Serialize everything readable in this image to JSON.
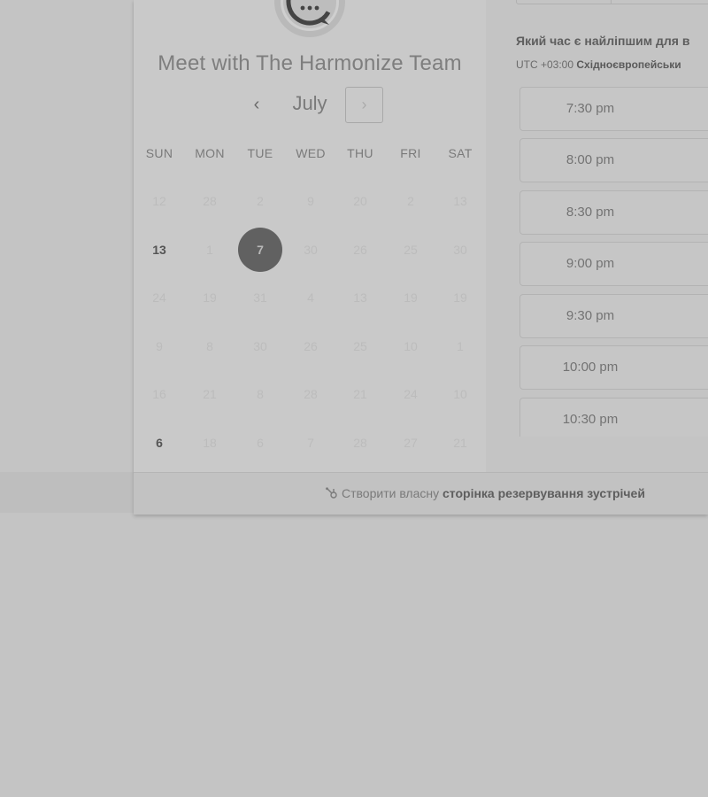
{
  "calendar": {
    "title": "Meet with The Harmonize Team",
    "month": "July",
    "prev_glyph": "‹",
    "next_glyph": "›",
    "weekdays": [
      "SUN",
      "MON",
      "TUE",
      "WED",
      "THU",
      "FRI",
      "SAT"
    ],
    "weeks": [
      [
        "12",
        "28",
        "2",
        "9",
        "20",
        "2",
        "13"
      ],
      [
        "13",
        "1",
        "7",
        "30",
        "26",
        "25",
        "30"
      ],
      [
        "24",
        "19",
        "31",
        "4",
        "13",
        "19",
        "19"
      ],
      [
        "9",
        "8",
        "30",
        "26",
        "25",
        "10",
        "1"
      ],
      [
        "16",
        "21",
        "8",
        "28",
        "21",
        "24",
        "10"
      ],
      [
        "6",
        "18",
        "6",
        "7",
        "28",
        "27",
        "21"
      ]
    ],
    "active_days": [
      "13",
      "6"
    ],
    "selected_day": "7"
  },
  "schedule": {
    "question": "Який час є найліпшим для в",
    "timezone_offset": "UTC +03:00",
    "timezone_name": "Східноєвропейськи",
    "slots": [
      "7:30 pm",
      "8:00 pm",
      "8:30 pm",
      "9:00 pm",
      "9:30 pm",
      "10:00 pm",
      "10:30 pm"
    ]
  },
  "footer": {
    "prefix": "Створити власну",
    "link": "сторінка резервування зустрічей"
  },
  "colors": {
    "background": "#c4c4c4",
    "selected_day": "#616161"
  }
}
